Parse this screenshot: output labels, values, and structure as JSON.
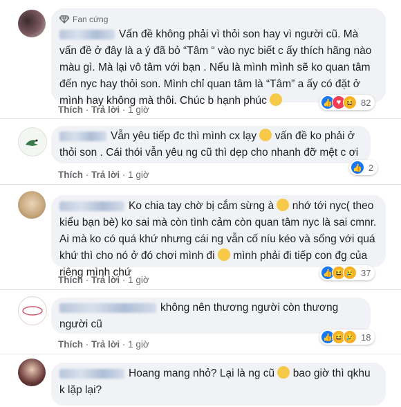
{
  "comments": [
    {
      "badge": "Fan cứng",
      "text": "Vấn đề không phải vì thỏi son hay vì người cũ. Mà vấn đề ở đây là a ý đã bỏ “Tâm “ vào nyc biết c ấy thích hãng nào màu gì. Mà lại vô tâm với bạn . Nếu là mình mình sẽ ko quan tâm đến nyc hay thỏi son. Mình chỉ quan tâm là “Tâm” a ấy có đặt ở mình hay không mà thôi. Chúc b hạnh phúc",
      "emoji": "smile-emoji",
      "like": "Thích",
      "reply": "Trả lời",
      "time": "1 giờ",
      "reactions": [
        "like",
        "love",
        "haha"
      ],
      "count": "82"
    },
    {
      "text": "Vẫn yêu tiếp đc thì mình cx lạy",
      "text2": "vấn đề ko phải ở thỏi son . Cái thói vẫn yêu ng cũ thì dẹp cho nhanh đỡ mệt c ơi",
      "emoji": "rofl-emoji",
      "like": "Thích",
      "reply": "Trả lời",
      "time": "1 giờ",
      "reactions": [
        "like"
      ],
      "count": "2"
    },
    {
      "text": "Ko chia tay chờ bị cắm sừng à",
      "text2": "nhớ tới nyc( theo kiểu bạn bè) ko sai mà còn tình cảm còn quan tâm nyc là sai cmnr. Ai mà ko có quá khứ nhưng cái ng vẫn cố níu kéo và sống với quá khứ thì cho nó ở đó chơi mình đi",
      "text3": "mình phải đi tiếp con đg của riêng mình chứ",
      "emoji": "laugh-emoji",
      "like": "Thích",
      "reply": "Trả lời",
      "time": "1 giờ",
      "reactions": [
        "like",
        "haha",
        "sad"
      ],
      "count": "37"
    },
    {
      "text": "không nên thương người còn thương người cũ",
      "like": "Thích",
      "reply": "Trả lời",
      "time": "1 giờ",
      "reactions": [
        "like",
        "haha",
        "sad"
      ],
      "count": "18"
    },
    {
      "text": "Hoang mang nhỏ? Lại là ng cũ",
      "text2": "bao giờ thì qkhu k lặp lại?",
      "emoji": "laugh-emoji"
    }
  ],
  "colors": {
    "accent": "#1877f2",
    "bubble": "#f0f2f5",
    "meta": "#65676b"
  }
}
